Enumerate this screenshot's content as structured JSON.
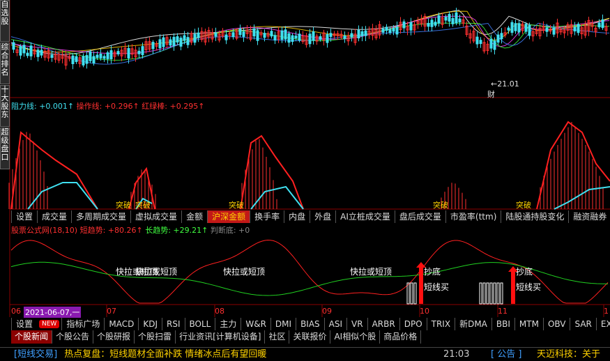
{
  "left_tabs": [
    "自选股",
    "综合排名",
    "十大股东",
    "超级盘口"
  ],
  "price_annotation": {
    "text": "←21.01",
    "cai": "财"
  },
  "panel1_legend": [
    {
      "text": "阻力线: +0.001↑",
      "color": "#40e0f0"
    },
    {
      "text": "操作线: +0.296↑",
      "color": "#ff3030"
    },
    {
      "text": "红绿棒: +0.295↑",
      "color": "#ff3030"
    }
  ],
  "panel1_labels": {
    "tupo": "突破"
  },
  "toolbar1": [
    "设置",
    "成交量",
    "多周期成交量",
    "虚拟成交量",
    "金额",
    "沪深金额",
    "换手率",
    "内盘",
    "外盘",
    "AI立桩成交量",
    "盘后成交量",
    "市盈率(ttm)",
    "陆股通持股变化",
    "融资融券"
  ],
  "toolbar1_active": 5,
  "panel2_legend": [
    {
      "text": "股票公式网(18,10)",
      "color": "#ff3030"
    },
    {
      "text": "短趋势: +80.26↑",
      "color": "#ff3030"
    },
    {
      "text": "长趋势: +29.21↑",
      "color": "#40ff40"
    },
    {
      "text": "判断底: +0",
      "color": "#888888"
    }
  ],
  "panel2_labels": {
    "kuai_1": "快拉或短顶",
    "kuai_1b": "快拉或短顶",
    "kuai_2": "快拉或短顶",
    "kuai_3": "快拉或短顶",
    "chaodi": "抄底",
    "duanxian": "短线买"
  },
  "date_axis": {
    "label_06": "06",
    "cursor": "2021-06-07,一",
    "m07": "07",
    "m08": "08",
    "m09": "09",
    "m10": "10",
    "m11": "11",
    "m1": "1"
  },
  "toolbar2_first": "设置",
  "toolbar2_new": "NEW",
  "toolbar2": [
    "指标广场",
    "MACD",
    "KDJ",
    "RSI",
    "BOLL",
    "主力",
    "W&R",
    "DMI",
    "BIAS",
    "ASI",
    "VR",
    "ARBR",
    "DPO",
    "TRIX",
    "新DMA",
    "BBI",
    "MTM",
    "OBV",
    "SAR",
    "EXP"
  ],
  "tabs": [
    "个股新闻",
    "个股公告",
    "个股研报",
    "个股扫雷",
    "行业资讯[计算机设备]",
    "社区",
    "关联报价",
    "AI相似个股",
    "商品价格"
  ],
  "tabs_active": 0,
  "ticker": {
    "tag": "[短线交易]",
    "headline": "热点复盘：短线题材全面补跌 情绪冰点后有望回暖",
    "time": "21:03",
    "notice_tag": "[ 公告 ]",
    "notice": "天迈科技：关于"
  },
  "colors": {
    "up": "#ff3030",
    "down": "#40e0f0",
    "short_trend": "#ff2020",
    "long_trend": "#20d020",
    "active_tab": "#c21818"
  }
}
